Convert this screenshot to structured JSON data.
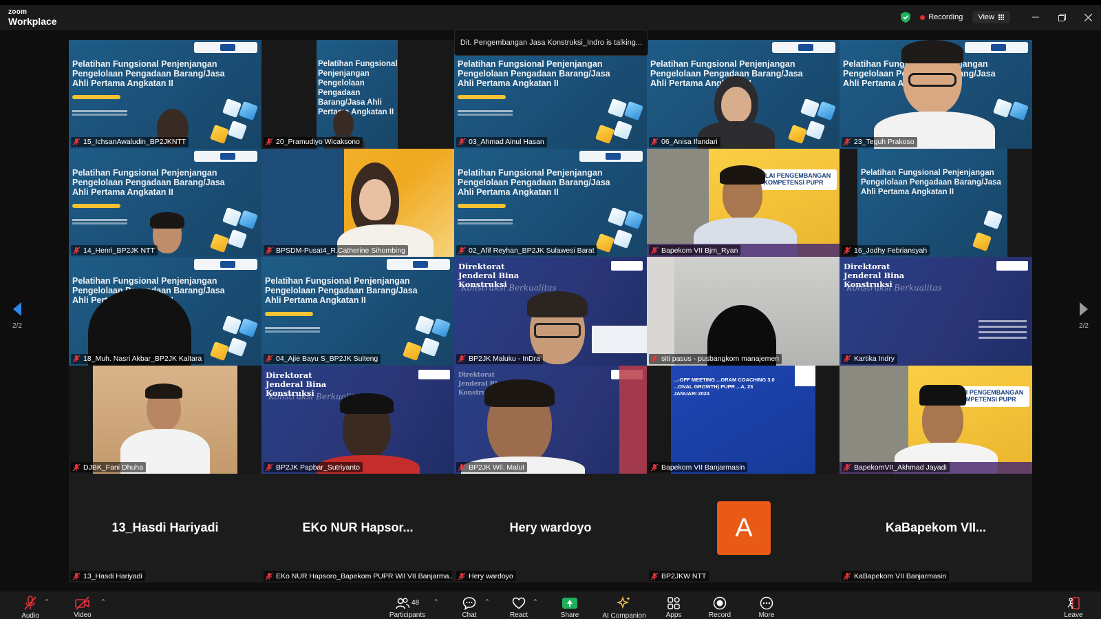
{
  "app": {
    "logo_small": "zoom",
    "logo_big": "Workplace"
  },
  "titlebar": {
    "recording_label": "Recording",
    "view_label": "View"
  },
  "talking_banner": "Dit. Pengembangan Jasa Konstruksi_Indro is talking...",
  "pager": {
    "left_page": "2/2",
    "right_page": "2/2"
  },
  "slide": {
    "title": "Pelatihan Fungsional Penjenjangan Pengelolaan Pengadaan Barang/Jasa Ahli Pertama Angkatan II",
    "dj_title": "Direktorat Jenderal Bina Konstruksi",
    "dj_script": "Konstruksi Berkualitas",
    "balai": "BALAI PENGEMBANGAN KOMPETENSI PUPR",
    "kickoff": "...-OFF MEETING ...GRAM COACHING 3.0 ...ONAL GROWTH) PUPR ...A, 23 JANUARI 2024"
  },
  "participants": [
    {
      "name": "15_IchsanAwaludin_BP2JKNTT"
    },
    {
      "name": "20_Pramudiyo Wicaksono"
    },
    {
      "name": "03_Ahmad Ainul Hasan"
    },
    {
      "name": "06_Anisa Ifandari"
    },
    {
      "name": "23_Teguh Prakoso"
    },
    {
      "name": "14_Henri_BP2JK NTT"
    },
    {
      "name": "BPSDM-Pusat4_R.Catherine Sihombing"
    },
    {
      "name": "02_Afif Reyhan_BP2JK Sulawesi Barat"
    },
    {
      "name": "Bapekom VII Bjm_Ryan"
    },
    {
      "name": "16_Jodhy Febriansyah"
    },
    {
      "name": "18_Muh. Nasri Akbar_BP2JK Kaltara"
    },
    {
      "name": "04_Ajie Bayu S_BP2JK Sulteng"
    },
    {
      "name": "BP2JK Maluku - InDra"
    },
    {
      "name": "siti pasus - pusbangkom manajemen"
    },
    {
      "name": "Kartika Indry"
    },
    {
      "name": "DJBK_Fani Dhuha"
    },
    {
      "name": "BP2JK Papbar_Sutriyanto"
    },
    {
      "name": "BP2JK Wil. Malut"
    },
    {
      "name": "Bapekom VII Banjarmasin"
    },
    {
      "name": "BapekomVII_Akhmad Jayadi"
    },
    {
      "name": "13_Hasdi Hariyadi",
      "display": "13_Hasdi Hariyadi"
    },
    {
      "name": "EKo NUR Hapsoro_Bapekom PUPR Wil VII Banjarma...",
      "display": "EKo NUR Hapsor..."
    },
    {
      "name": "Hery wardoyo",
      "display": "Hery wardoyo"
    },
    {
      "name": "BP2JKW NTT",
      "avatar": "A"
    },
    {
      "name": "KaBapekom VII Banjarmasin",
      "display": "KaBapekom VII..."
    }
  ],
  "toolbar": {
    "audio": "Audio",
    "video": "Video",
    "participants": "Participants",
    "participants_count": "48",
    "chat": "Chat",
    "react": "React",
    "share": "Share",
    "ai_companion": "AI Companion",
    "apps": "Apps",
    "record": "Record",
    "more": "More",
    "leave": "Leave"
  },
  "colors": {
    "muted_red": "#e0353b",
    "avatar_orange": "#e85a16",
    "share_green": "#1fb05b",
    "recording_red": "#e02f2f"
  }
}
